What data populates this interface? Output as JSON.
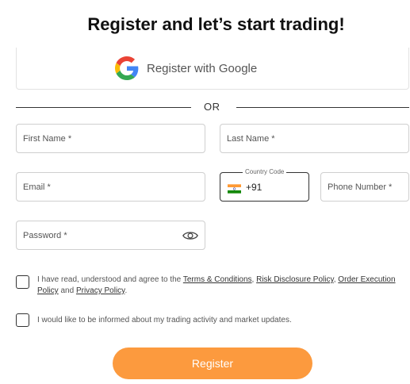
{
  "page": {
    "title": "Register and let’s start trading!"
  },
  "google": {
    "label": "Register with Google",
    "icon": "google-icon"
  },
  "divider": {
    "label": "OR"
  },
  "form": {
    "first_name": {
      "placeholder": "First Name *"
    },
    "last_name": {
      "placeholder": "Last Name *"
    },
    "email": {
      "placeholder": "Email *"
    },
    "country_code": {
      "label": "Country Code",
      "flag": "india-flag-icon",
      "value": "+91"
    },
    "phone": {
      "placeholder": "Phone Number *"
    },
    "password": {
      "placeholder": "Password *",
      "toggle_icon": "eye-icon"
    }
  },
  "consent": {
    "terms_prefix": "I have read, understood and agree to the ",
    "terms_link": "Terms & Conditions",
    "sep1": ", ",
    "risk_link": "Risk Disclosure Policy",
    "sep2": ", ",
    "order_link": "Order Execution Policy",
    "and_text": " and ",
    "privacy_link": "Privacy Policy",
    "end": ".",
    "updates_text": "I would like to be informed about my trading activity and market updates."
  },
  "actions": {
    "register_label": "Register"
  },
  "colors": {
    "accent": "#fc9a3e",
    "border": "#cfcfcf"
  }
}
